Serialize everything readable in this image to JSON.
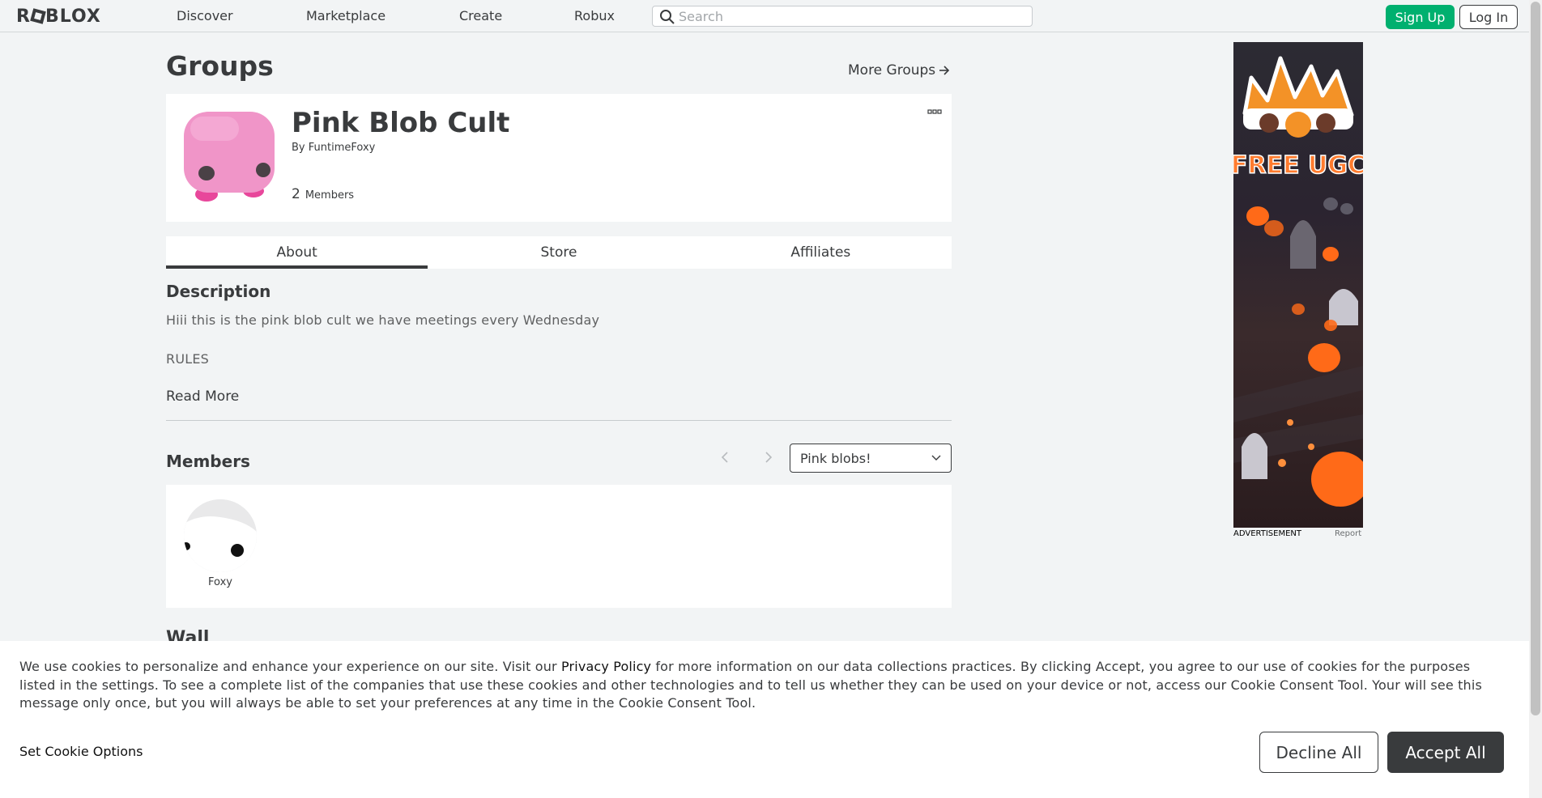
{
  "header": {
    "logo_text": "ROBLOX",
    "nav": [
      "Discover",
      "Marketplace",
      "Create",
      "Robux"
    ],
    "search_placeholder": "Search",
    "signup_label": "Sign Up",
    "login_label": "Log In"
  },
  "page": {
    "title": "Groups",
    "more_groups": "More Groups"
  },
  "group": {
    "name": "Pink Blob Cult",
    "by_label": "By",
    "owner": "FuntimeFoxy",
    "member_count": "2",
    "members_label": "Members"
  },
  "tabs": [
    {
      "label": "About",
      "active": true
    },
    {
      "label": "Store",
      "active": false
    },
    {
      "label": "Affiliates",
      "active": false
    }
  ],
  "about": {
    "description_heading": "Description",
    "description_line1": "Hiii this is the pink blob cult we have meetings every Wednesday",
    "description_line2": "RULES",
    "read_more": "Read More"
  },
  "members": {
    "heading": "Members",
    "role_selected": "Pink blobs!",
    "list": [
      {
        "name": "Foxy"
      }
    ]
  },
  "wall": {
    "heading": "Wall"
  },
  "ad": {
    "headline": "FREE UGC",
    "label": "ADVERTISEMENT",
    "report": "Report"
  },
  "cookie": {
    "text_part1": "We use cookies to personalize and enhance your experience on our site. Visit our ",
    "privacy_link": "Privacy Policy",
    "text_part2": " for more information on our data collections practices. By clicking Accept, you agree to our use of cookies for the purposes listed in the settings. To see a complete list of the companies that use these cookies and other technologies and to tell us whether they can be used on your device or not, access our Cookie Consent Tool. Your will see this message only once, but you will always be able to set your preferences at any time in the Cookie Consent Tool.",
    "set_options": "Set Cookie Options",
    "decline": "Decline All",
    "accept": "Accept All"
  },
  "colors": {
    "signup_green": "#00b06f",
    "text_dark": "#393b3d",
    "page_bg": "#f2f4f5",
    "blob_pink": "#ee8cc8"
  }
}
